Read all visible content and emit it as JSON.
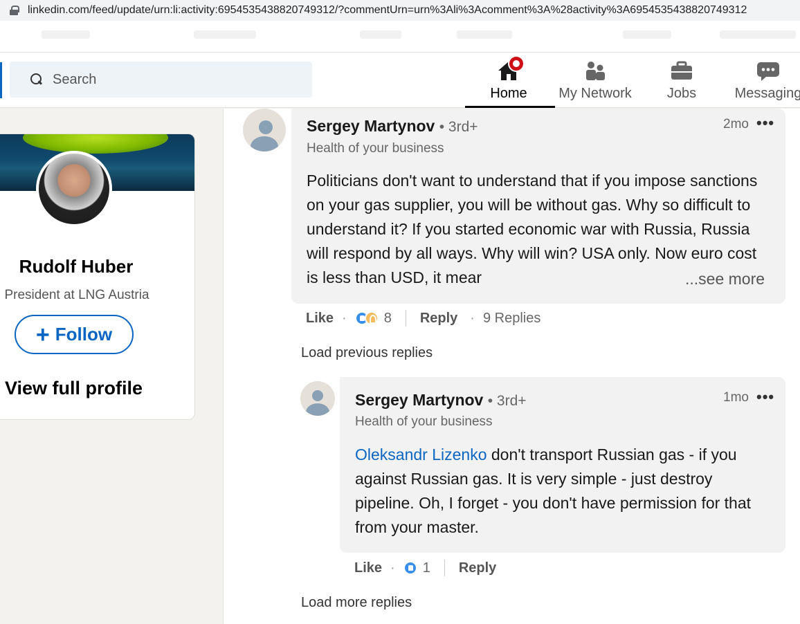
{
  "browser": {
    "url": "linkedin.com/feed/update/urn:li:activity:6954535438820749312/?commentUrn=urn%3Ali%3Acomment%3A%28activity%3A6954535438820749312"
  },
  "nav": {
    "search_placeholder": "Search",
    "items": [
      {
        "label": "Home",
        "icon": "home-icon",
        "active": true
      },
      {
        "label": "My Network",
        "icon": "people-icon"
      },
      {
        "label": "Jobs",
        "icon": "briefcase-icon"
      },
      {
        "label": "Messaging",
        "icon": "chat-icon"
      }
    ]
  },
  "profile": {
    "name": "Rudolf Huber",
    "headline": "President at LNG Austria",
    "follow_label": "Follow",
    "follow_icon": "+",
    "view_full": "View full profile"
  },
  "comment": {
    "author": "Sergey Martynov",
    "degree": "• 3rd+",
    "headline": "Health of your business",
    "time": "2mo",
    "menu": "•••",
    "text": "Politicians don't want to understand that if you impose sanctions on your gas supplier, you will be without gas. Why so difficult to understand it? If you started economic war with Russia, Russia will respond by all ways. Why will win? USA only. Now euro cost is less than USD, it mear",
    "see_more": "...see more",
    "like": "Like",
    "dot": "·",
    "reaction_count": "8",
    "reply": "Reply",
    "replies": "9 Replies"
  },
  "load_previous": "Load previous replies",
  "reply": {
    "author": "Sergey Martynov",
    "degree": "• 3rd+",
    "headline": "Health of your business",
    "time": "1mo",
    "menu": "•••",
    "mention": "Oleksandr Lizenko",
    "text": " don't transport Russian gas - if you against Russian gas. It is very simple - just destroy pipeline. Oh, I forget - you don't have permission for that from your master.",
    "like": "Like",
    "dot": "·",
    "reaction_count": "1",
    "reply": "Reply"
  },
  "load_more": "Load more replies",
  "colors": {
    "brand": "#0a66c2",
    "badge": "#cc1016"
  }
}
